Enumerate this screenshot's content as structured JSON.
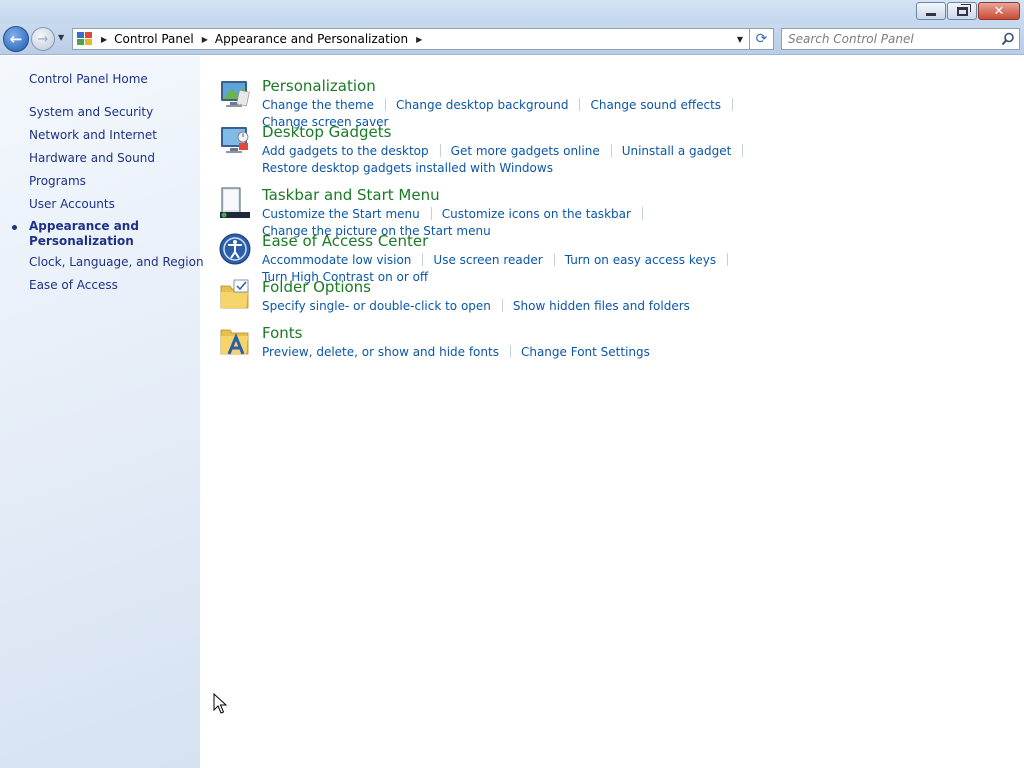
{
  "window": {
    "minimize_glyph": "minimize-icon",
    "maximize_glyph": "restore-icon",
    "close_label": "✕"
  },
  "nav": {
    "back_label": "←",
    "forward_label": "→",
    "recent_label": "▼",
    "breadcrumbs": [
      "Control Panel",
      "Appearance and Personalization"
    ],
    "dropdown_label": "▼",
    "refresh_label": "⟳",
    "search_placeholder": "Search Control Panel"
  },
  "sidebar": {
    "home": "Control Panel Home",
    "items": [
      "System and Security",
      "Network and Internet",
      "Hardware and Sound",
      "Programs",
      "User Accounts",
      "Appearance and Personalization",
      "Clock, Language, and Region",
      "Ease of Access"
    ],
    "current_index": 5
  },
  "categories": [
    {
      "title": "Personalization",
      "icon": "personalization-icon",
      "links": [
        "Change the theme",
        "Change desktop background",
        "Change sound effects",
        "Change screen saver"
      ]
    },
    {
      "title": "Desktop Gadgets",
      "icon": "desktop-gadgets-icon",
      "links": [
        "Add gadgets to the desktop",
        "Get more gadgets online",
        "Uninstall a gadget",
        "Restore desktop gadgets installed with Windows"
      ]
    },
    {
      "title": "Taskbar and Start Menu",
      "icon": "taskbar-icon",
      "links": [
        "Customize the Start menu",
        "Customize icons on the taskbar",
        "Change the picture on the Start menu"
      ]
    },
    {
      "title": "Ease of Access Center",
      "icon": "ease-of-access-icon",
      "links": [
        "Accommodate low vision",
        "Use screen reader",
        "Turn on easy access keys",
        "Turn High Contrast on or off"
      ]
    },
    {
      "title": "Folder Options",
      "icon": "folder-options-icon",
      "links": [
        "Specify single- or double-click to open",
        "Show hidden files and folders"
      ]
    },
    {
      "title": "Fonts",
      "icon": "fonts-icon",
      "links": [
        "Preview, delete, or show and hide fonts",
        "Change Font Settings"
      ]
    }
  ],
  "colors": {
    "category_title": "#1b7a24",
    "task_link": "#0b56a8",
    "sidebar_link": "#1e3287"
  }
}
